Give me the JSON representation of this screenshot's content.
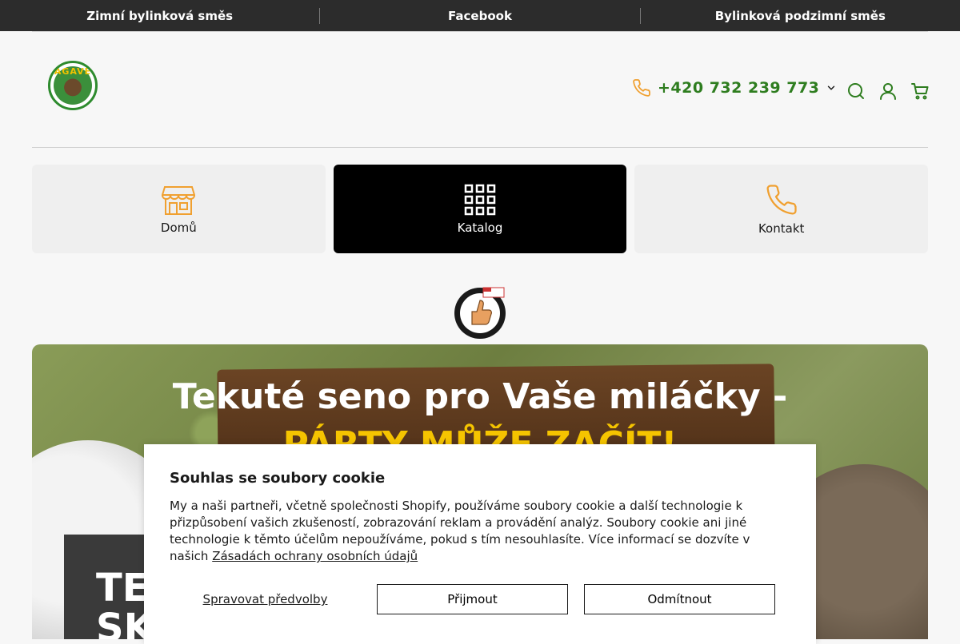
{
  "announcements": [
    "Zimní bylinková směs",
    "Facebook",
    "Bylinková podzimní směs"
  ],
  "logo": {
    "text": "AGAVE"
  },
  "header": {
    "phone": "+420 732 239 773"
  },
  "nav": {
    "items": [
      {
        "label": "Domů"
      },
      {
        "label": "Katalog"
      },
      {
        "label": "Kontakt"
      }
    ]
  },
  "hero": {
    "line1": "Tekuté seno pro Vaše miláčky -",
    "line2": "PÁRTY MŮŽE ZAČÍT!",
    "overlay_line1": "TE",
    "overlay_line2": "SK"
  },
  "cookie": {
    "title": "Souhlas se soubory cookie",
    "body": "My a naši partneři, včetně společnosti Shopify, používáme soubory cookie a další technologie k přizpůsobení vašich zkušeností, zobrazování reklam a provádění analýz. Soubory cookie ani jiné technologie k těmto účelům nepoužíváme, pokud s tím nesouhlasíte. Více informací se dozvíte v našich",
    "link": "Zásadách ochrany osobních údajů",
    "manage": "Spravovat předvolby",
    "accept": "Přijmout",
    "decline": "Odmítnout"
  },
  "colors": {
    "accent_green": "#2e7d1f",
    "icon_orange": "#f0a030",
    "topbar": "#2c2c2c"
  }
}
